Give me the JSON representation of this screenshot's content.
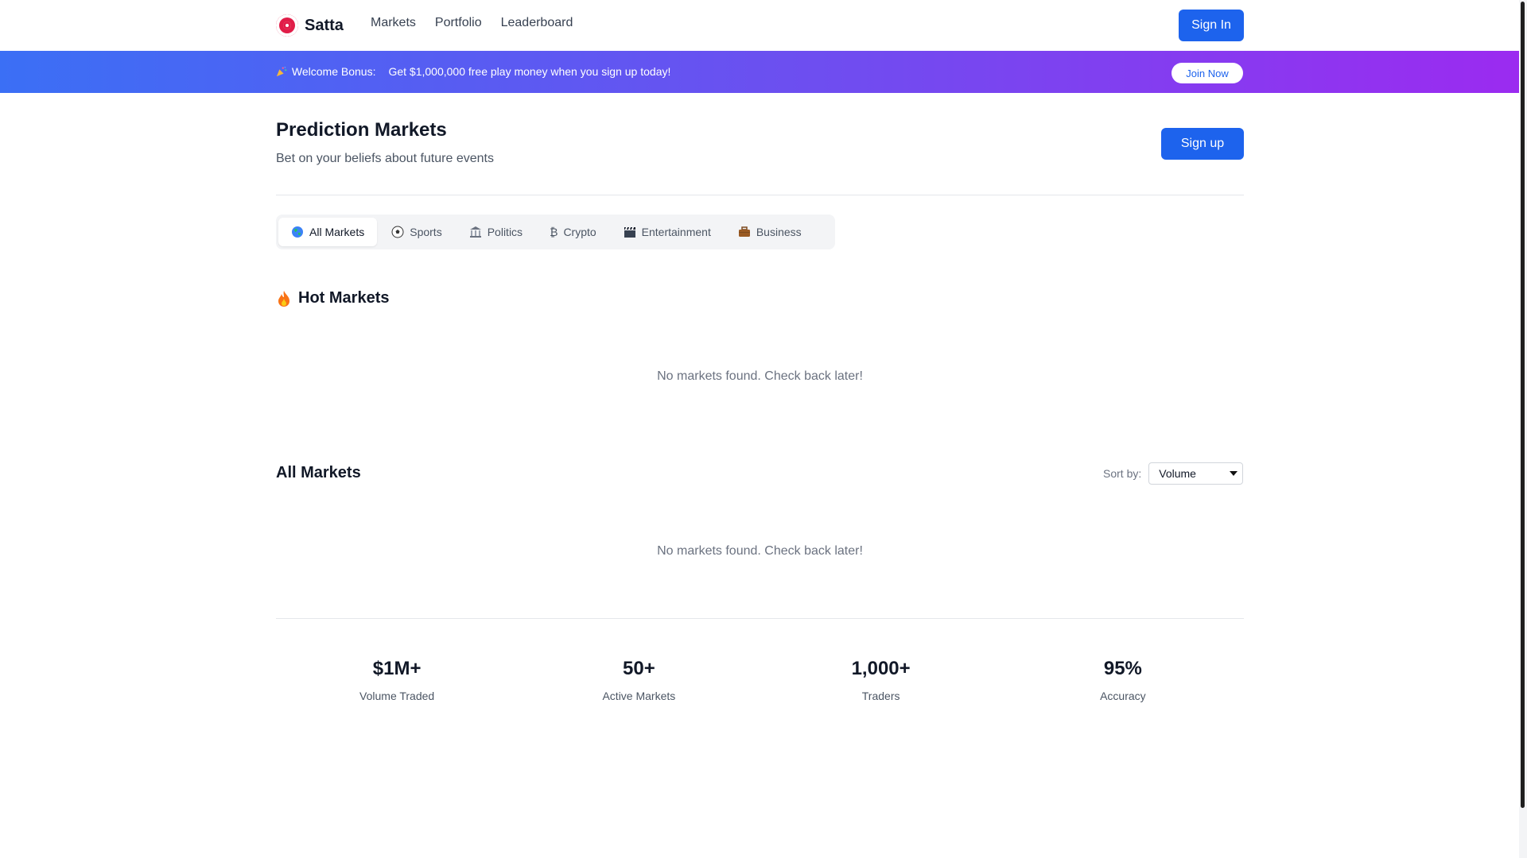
{
  "header": {
    "brand": "Satta",
    "nav": [
      "Markets",
      "Portfolio",
      "Leaderboard"
    ],
    "signin_label": "Sign In",
    "brand_icon": "target-icon"
  },
  "banner": {
    "icon": "party-popper-icon",
    "label": "Welcome Bonus:",
    "message": "Get $1,000,000 free play money when you sign up today!",
    "cta": "Join Now"
  },
  "page": {
    "title": "Prediction Markets",
    "subtitle": "Bet on your beliefs about future events",
    "signup_label": "Sign up"
  },
  "categories": [
    {
      "label": "All Markets",
      "icon": "globe-icon",
      "active": true
    },
    {
      "label": "Sports",
      "icon": "soccer-ball-icon",
      "active": false
    },
    {
      "label": "Politics",
      "icon": "classical-building-icon",
      "active": false
    },
    {
      "label": "Crypto",
      "icon": "bitcoin-icon",
      "active": false
    },
    {
      "label": "Entertainment",
      "icon": "clapperboard-icon",
      "active": false
    },
    {
      "label": "Business",
      "icon": "briefcase-icon",
      "active": false
    }
  ],
  "hot_markets": {
    "title": "Hot Markets",
    "icon": "fire-icon",
    "empty_text": "No markets found. Check back later!"
  },
  "all_markets": {
    "title": "All Markets",
    "sort_label": "Sort by:",
    "sort_value": "Volume",
    "empty_text": "No markets found. Check back later!"
  },
  "stats": [
    {
      "value": "$1M+",
      "label": "Volume Traded"
    },
    {
      "value": "50+",
      "label": "Active Markets"
    },
    {
      "value": "1,000+",
      "label": "Traders"
    },
    {
      "value": "95%",
      "label": "Accuracy"
    }
  ],
  "colors": {
    "primary": "#1d63ed",
    "banner_start": "#3b6ff5",
    "banner_end": "#9b2bf0"
  }
}
